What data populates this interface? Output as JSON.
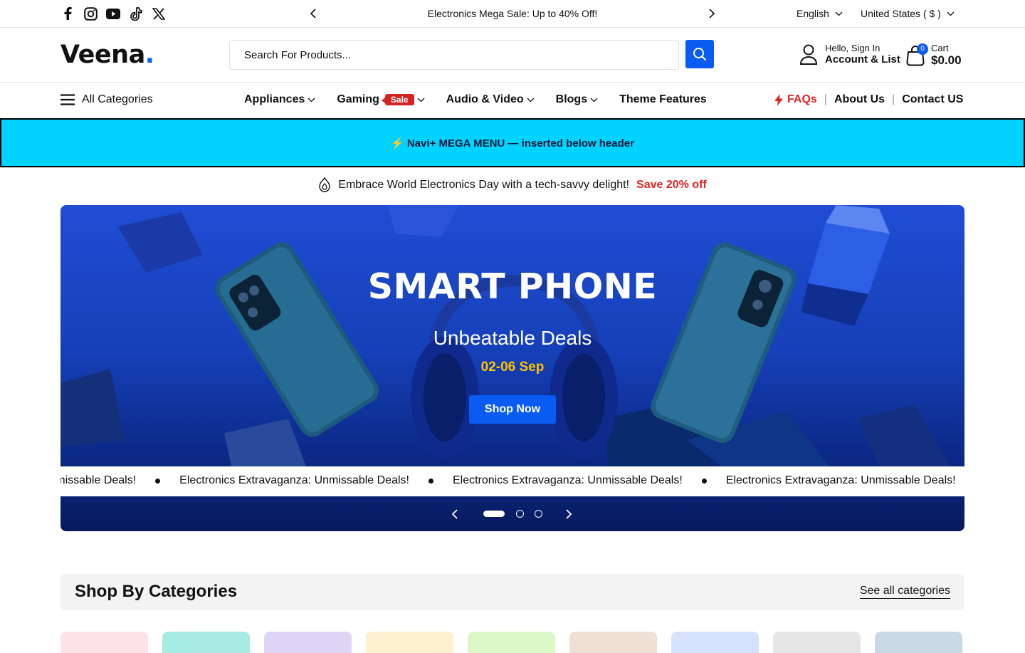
{
  "topbar": {
    "social_icons": [
      "facebook-icon",
      "instagram-icon",
      "youtube-icon",
      "tiktok-icon",
      "x-icon"
    ],
    "announcement": "Electronics Mega Sale: Up to 40% Off!",
    "language": "English",
    "country": "United States ( $ )"
  },
  "header": {
    "logo": "Veena",
    "logo_dot": ".",
    "search_placeholder": "Search For Products...",
    "account_line1": "Hello, Sign In",
    "account_line2": "Account & List",
    "cart_count": "0",
    "cart_label": "Cart",
    "cart_total": "$0.00"
  },
  "nav": {
    "all_categories": "All Categories",
    "items": [
      {
        "label": "Appliances"
      },
      {
        "label": "Gaming",
        "badge": "Sale"
      },
      {
        "label": "Audio & Video"
      },
      {
        "label": "Blogs"
      },
      {
        "label": "Theme Features"
      }
    ],
    "faqs": "FAQs",
    "about": "About Us",
    "contact": "Contact US",
    "separator": "|"
  },
  "mega_banner": "⚡ Navi+ MEGA MENU — inserted below header",
  "promo": {
    "text": "Embrace World Electronics Day with a tech-savvy delight!",
    "highlight": "Save 20% off"
  },
  "hero": {
    "title": "SMART PHONE",
    "subtitle": "Unbeatable Deals",
    "date": "02-06 Sep",
    "button": "Shop Now",
    "marquee_text": "Electronics Extravaganza: Unmissable Deals!",
    "marquee_first": "za: Unmissable Deals!",
    "slide_count": 3,
    "active_slide": 1
  },
  "categories": {
    "title": "Shop By Categories",
    "see_all": "See all categories",
    "tile_colors": [
      "#fde3e6",
      "#a6ece3",
      "#ddd4f6",
      "#fdf0cf",
      "#dcf7c7",
      "#efe0d5",
      "#d6e2fb",
      "#e6e6e6",
      "#cad8e6"
    ]
  },
  "colors": {
    "accent": "#0a5bf2",
    "sale": "#d32424",
    "mega": "#00d3ff",
    "date": "#ffc400"
  }
}
